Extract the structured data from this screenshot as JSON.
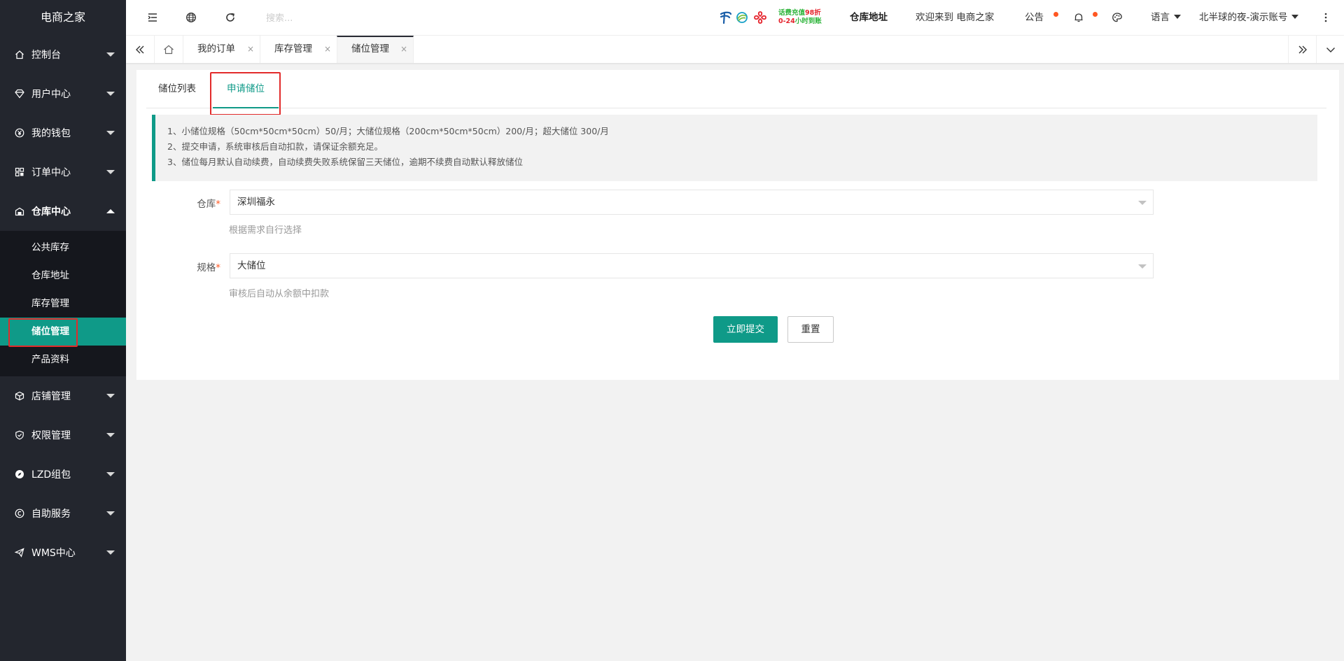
{
  "app": {
    "logo": "电商之家"
  },
  "sidebar": {
    "items": [
      {
        "label": "控制台",
        "icon": "home-icon"
      },
      {
        "label": "用户中心",
        "icon": "diamond-icon"
      },
      {
        "label": "我的钱包",
        "icon": "yen-icon"
      },
      {
        "label": "订单中心",
        "icon": "apps-icon"
      },
      {
        "label": "仓库中心",
        "icon": "warehouse-icon"
      },
      {
        "label": "店铺管理",
        "icon": "cube-icon"
      },
      {
        "label": "权限管理",
        "icon": "shield-icon"
      },
      {
        "label": "LZD组包",
        "icon": "compass-icon"
      },
      {
        "label": "自助服务",
        "icon": "service-icon"
      },
      {
        "label": "WMS中心",
        "icon": "send-icon"
      }
    ],
    "warehouse_sub": [
      {
        "label": "公共库存"
      },
      {
        "label": "仓库地址"
      },
      {
        "label": "库存管理"
      },
      {
        "label": "储位管理"
      },
      {
        "label": "产品资料"
      }
    ]
  },
  "header": {
    "search_placeholder": "搜索...",
    "promo_line1_a": "话费充值",
    "promo_line1_b": "98折",
    "promo_line2_a": "0-24",
    "promo_line2_b": "小时到账",
    "warehouse_address": "仓库地址",
    "welcome": "欢迎来到 电商之家",
    "announcement": "公告",
    "language": "语言",
    "account": "北半球的夜-演示账号"
  },
  "tabs": [
    {
      "label": "我的订单"
    },
    {
      "label": "库存管理"
    },
    {
      "label": "储位管理"
    }
  ],
  "tab_close_glyph": "×",
  "content": {
    "inner_tabs": [
      "储位列表",
      "申请储位"
    ],
    "notes": [
      "1、小储位规格（50cm*50cm*50cm）50/月；大储位规格（200cm*50cm*50cm）200/月；超大储位 300/月",
      "2、提交申请，系统审核后自动扣款，请保证余额充足。",
      "3、储位每月默认自动续费，自动续费失败系统保留三天储位，逾期不续费自动默认释放储位"
    ],
    "warehouse_label": "仓库",
    "warehouse_value": "深圳福永",
    "warehouse_hint": "根据需求自行选择",
    "spec_label": "规格",
    "spec_value": "大储位",
    "spec_hint": "审核后自动从余额中扣款",
    "required_mark": "*",
    "submit_label": "立即提交",
    "reset_label": "重置"
  },
  "colors": {
    "accent": "#0f9a88",
    "sidebar_bg": "#23262e",
    "highlight": "#e22b2b",
    "dot": "#ff5722"
  }
}
